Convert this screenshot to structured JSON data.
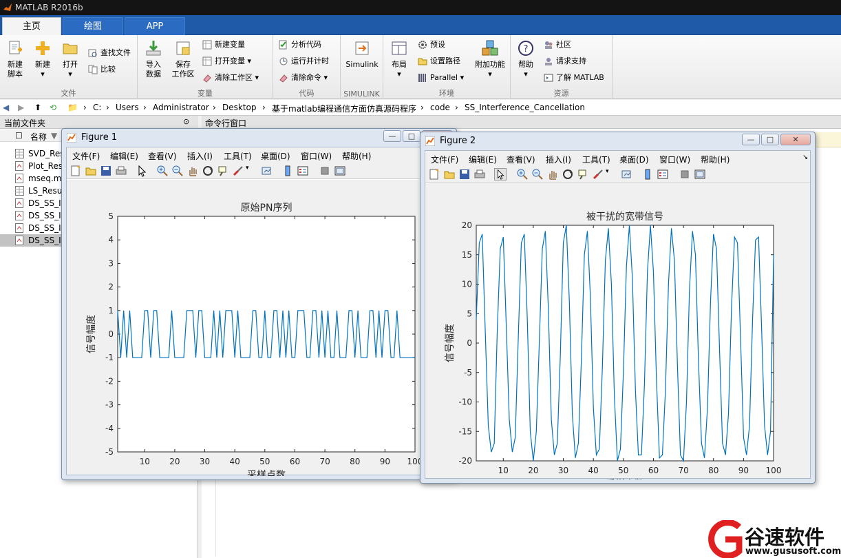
{
  "app": {
    "title": "MATLAB R2016b"
  },
  "tabs": [
    {
      "label": "主页",
      "active": true
    },
    {
      "label": "绘图",
      "active": false
    },
    {
      "label": "APP",
      "active": false
    }
  ],
  "ribbon": {
    "file_group": {
      "caption": "文件",
      "new_script": "新建\n脚本",
      "new_script_l1": "新建",
      "new_script_l2": "脚本",
      "new": "新建",
      "open": "打开",
      "find_files": "查找文件",
      "compare": "比较"
    },
    "variable_group": {
      "caption": "变量",
      "import": "导入",
      "import_l2": "数据",
      "save": "保存",
      "save_l2": "工作区",
      "new_variable": "新建变量",
      "open_variable": "打开变量",
      "clear_workspace": "清除工作区"
    },
    "code_group": {
      "caption": "代码",
      "analyze": "分析代码",
      "run_time": "运行并计时",
      "clear_commands": "清除命令"
    },
    "simulink_group": {
      "caption": "SIMULINK",
      "simulink": "Simulink"
    },
    "env_group": {
      "caption": "环境",
      "layout": "布局",
      "preferences": "预设",
      "set_path": "设置路径",
      "parallel": "Parallel",
      "addons": "附加功能"
    },
    "resources_group": {
      "caption": "资源",
      "help": "帮助",
      "community": "社区",
      "support": "请求支持",
      "learn": "了解 MATLAB"
    }
  },
  "address": {
    "parts": [
      "C:",
      "Users",
      "Administrator",
      "Desktop",
      "基于matlab编程通信方面仿真源码程序",
      "code",
      "SS_Interference_Cancellation"
    ]
  },
  "left_panel": {
    "title": "当前文件夹",
    "col_name": "名称",
    "files": [
      "SVD_Res",
      "Plot_Res",
      "mseq.m",
      "LS_Resu",
      "DS_SS_Ir",
      "DS_SS_Ir",
      "DS_SS_Ir",
      "DS_SS_Ir"
    ]
  },
  "cmd_panel": {
    "title": "命令行窗口"
  },
  "figure1": {
    "title": "Figure 1",
    "menu": [
      "文件(F)",
      "编辑(E)",
      "查看(V)",
      "插入(I)",
      "工具(T)",
      "桌面(D)",
      "窗口(W)",
      "帮助(H)"
    ]
  },
  "figure2": {
    "title": "Figure 2",
    "menu": [
      "文件(F)",
      "编辑(E)",
      "查看(V)",
      "插入(I)",
      "工具(T)",
      "桌面(D)",
      "窗口(W)",
      "帮助(H)"
    ]
  },
  "watermark": {
    "brand": "谷速软件",
    "url": "www.gususoft.com"
  },
  "chart_data": [
    {
      "type": "line",
      "title": "原始PN序列",
      "xlabel": "采样点数",
      "ylabel": "信号幅度",
      "xlim": [
        1,
        100
      ],
      "ylim": [
        -5,
        5
      ],
      "xticks": [
        10,
        20,
        30,
        40,
        50,
        60,
        70,
        80,
        90,
        100
      ],
      "yticks": [
        -5,
        -4,
        -3,
        -2,
        -1,
        0,
        1,
        2,
        3,
        4,
        5
      ],
      "color": "#0072bd",
      "x": [
        1,
        2,
        3,
        4,
        5,
        6,
        7,
        8,
        9,
        10,
        11,
        12,
        13,
        14,
        15,
        16,
        17,
        18,
        19,
        20,
        21,
        22,
        23,
        24,
        25,
        26,
        27,
        28,
        29,
        30,
        31,
        32,
        33,
        34,
        35,
        36,
        37,
        38,
        39,
        40,
        41,
        42,
        43,
        44,
        45,
        46,
        47,
        48,
        49,
        50,
        51,
        52,
        53,
        54,
        55,
        56,
        57,
        58,
        59,
        60,
        61,
        62,
        63,
        64,
        65,
        66,
        67,
        68,
        69,
        70,
        71,
        72,
        73,
        74,
        75,
        76,
        77,
        78,
        79,
        80,
        81,
        82,
        83,
        84,
        85,
        86,
        87,
        88,
        89,
        90,
        91,
        92,
        93,
        94,
        95,
        96,
        97,
        98,
        99,
        100
      ],
      "y": [
        1,
        -1,
        1,
        -1,
        1,
        -1,
        -1,
        -1,
        -1,
        1,
        1,
        -1,
        1,
        1,
        -1,
        -1,
        -1,
        -1,
        1,
        -1,
        -1,
        -1,
        -1,
        1,
        1,
        1,
        -1,
        1,
        1,
        -1,
        -1,
        -1,
        1,
        -1,
        1,
        -1,
        1,
        1,
        1,
        -1,
        1,
        -1,
        -1,
        -1,
        -1,
        1,
        1,
        -1,
        -1,
        1,
        -1,
        -1,
        1,
        1,
        -1,
        1,
        -1,
        1,
        -1,
        -1,
        1,
        1,
        1,
        -1,
        -1,
        1,
        1,
        -1,
        1,
        -1,
        1,
        -1,
        -1,
        1,
        -1,
        -1,
        -1,
        1,
        1,
        -1,
        1,
        -1,
        -1,
        -1,
        1,
        1,
        -1,
        1,
        -1,
        1,
        1,
        -1,
        -1,
        1,
        -1,
        -1,
        -1,
        -1,
        -1,
        -1
      ]
    },
    {
      "type": "line",
      "title": "被干扰的宽带信号",
      "xlabel": "采样点数",
      "ylabel": "信号幅度",
      "xlim": [
        1,
        100
      ],
      "ylim": [
        -20,
        20
      ],
      "xticks": [
        10,
        20,
        30,
        40,
        50,
        60,
        70,
        80,
        90,
        100
      ],
      "yticks": [
        -20,
        -15,
        -10,
        -5,
        0,
        5,
        10,
        15,
        20
      ],
      "color": "#0072bd",
      "x": [
        1,
        2,
        3,
        4,
        5,
        6,
        7,
        8,
        9,
        10,
        11,
        12,
        13,
        14,
        15,
        16,
        17,
        18,
        19,
        20,
        21,
        22,
        23,
        24,
        25,
        26,
        27,
        28,
        29,
        30,
        31,
        32,
        33,
        34,
        35,
        36,
        37,
        38,
        39,
        40,
        41,
        42,
        43,
        44,
        45,
        46,
        47,
        48,
        49,
        50,
        51,
        52,
        53,
        54,
        55,
        56,
        57,
        58,
        59,
        60,
        61,
        62,
        63,
        64,
        65,
        66,
        67,
        68,
        69,
        70,
        71,
        72,
        73,
        74,
        75,
        76,
        77,
        78,
        79,
        80,
        81,
        82,
        83,
        84,
        85,
        86,
        87,
        88,
        89,
        90,
        91,
        92,
        93,
        94,
        95,
        96,
        97,
        98,
        99,
        100
      ],
      "y": [
        4,
        17,
        18.5,
        2,
        -14,
        -18.5,
        -17,
        2,
        16,
        18,
        3,
        -13,
        -18.5,
        -16,
        1,
        17,
        18.5,
        4,
        -15,
        -20,
        -15,
        0,
        16,
        19,
        6,
        -13,
        -19,
        -17,
        -2,
        17,
        20,
        7,
        -12,
        -19.5,
        -17,
        -3,
        15,
        19,
        8,
        -11,
        -19,
        -18,
        -4,
        14,
        19.5,
        10,
        -9,
        -20,
        -18,
        -5,
        13,
        20,
        11,
        -8,
        -19,
        -19,
        -7,
        12,
        20,
        12,
        -6,
        -19.5,
        -19,
        -8,
        10,
        19.5,
        14,
        -4,
        -19,
        -20,
        -10,
        9,
        19,
        15,
        -3,
        -17,
        -19.5,
        -11,
        7,
        18.5,
        16,
        -1,
        -17,
        -19,
        -12,
        6,
        18,
        17,
        1,
        -16,
        -19,
        -14,
        4,
        17.5,
        18,
        3,
        -14,
        -19,
        -15,
        15
      ]
    }
  ]
}
